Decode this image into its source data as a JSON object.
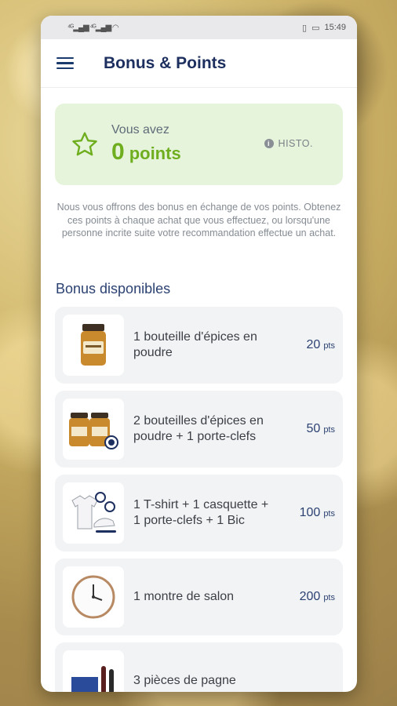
{
  "status": {
    "left_icons": "4G signal",
    "time": "15:49"
  },
  "header": {
    "title": "Bonus & Points"
  },
  "points": {
    "label": "Vous avez",
    "value": "0",
    "unit": "points",
    "history_label": "HISTO."
  },
  "intro": "Nous vous offrons des bonus en échange de vos points. Obtenez ces points à chaque achat que vous effectuez, ou lorsqu'une personne incrite suite votre recommandation effectue un achat.",
  "section_title": "Bonus disponibles",
  "bonuses": [
    {
      "title": "1 bouteille d'épices en poudre",
      "points": "20",
      "unit": "pts",
      "icon": "spice-jar-icon"
    },
    {
      "title": "2 bouteilles d'épices en poudre + 1 porte-clefs",
      "points": "50",
      "unit": "pts",
      "icon": "spice-jars-keychain-icon"
    },
    {
      "title": "1 T-shirt + 1 casquette + 1 porte-clefs + 1 Bic",
      "points": "100",
      "unit": "pts",
      "icon": "tshirt-cap-icon"
    },
    {
      "title": "1 montre de salon",
      "points": "200",
      "unit": "pts",
      "icon": "wall-clock-icon"
    },
    {
      "title": "3 pièces de pagne",
      "points": "",
      "unit": "",
      "icon": "fabric-bottles-icon"
    }
  ],
  "colors": {
    "accent_green": "#6fae1f",
    "card_green_bg": "#e6f4dc",
    "navy": "#1d2f5f"
  }
}
